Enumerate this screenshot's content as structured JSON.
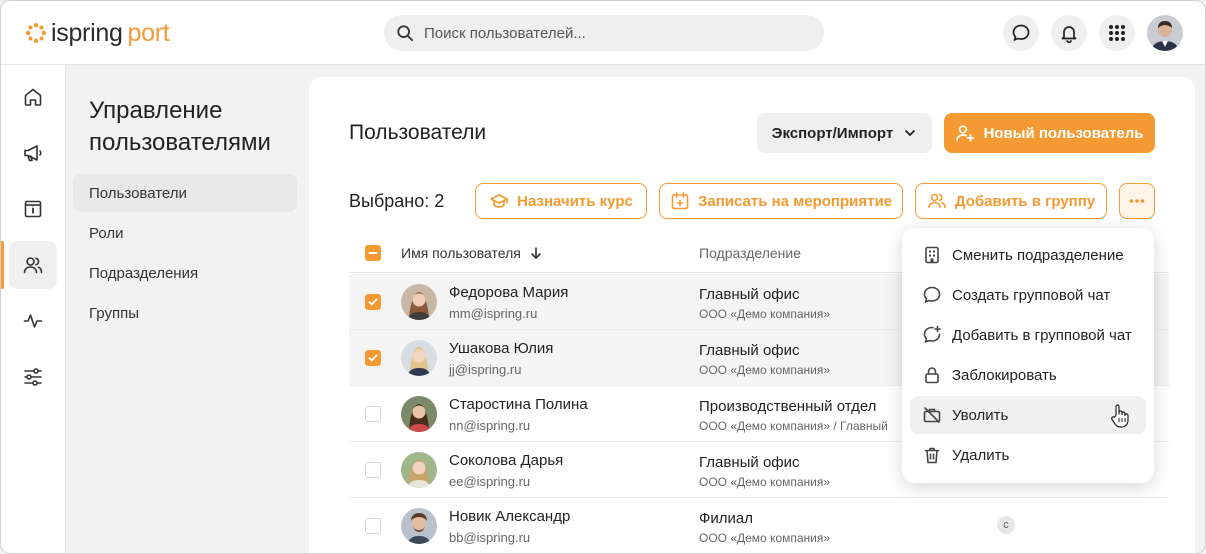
{
  "brand": {
    "logo_part1": "ispring",
    "logo_part2": "port",
    "accent": "#f59a32"
  },
  "search": {
    "placeholder": "Поиск пользователей..."
  },
  "header_icons": [
    "chat-icon",
    "bell-icon",
    "apps-grid-icon",
    "user-avatar"
  ],
  "rail": [
    "home-icon",
    "megaphone-icon",
    "info-board-icon",
    "users-icon",
    "activity-icon",
    "sliders-icon"
  ],
  "section": {
    "title": "Управление пользователями",
    "items": [
      {
        "label": "Пользователи",
        "active": true
      },
      {
        "label": "Роли",
        "active": false
      },
      {
        "label": "Подразделения",
        "active": false
      },
      {
        "label": "Группы",
        "active": false
      }
    ]
  },
  "main": {
    "title": "Пользователи",
    "export_label": "Экспорт/Импорт",
    "new_user_label": "Новый пользователь",
    "selected_text": "Выбрано: 2",
    "actions": {
      "assign_course": "Назначить курс",
      "enroll_event": "Записать на мероприятие",
      "add_to_group": "Добавить в группу"
    }
  },
  "table": {
    "col_name": "Имя пользователя",
    "col_department": "Подразделение",
    "rows": [
      {
        "name": "Федорова Мария",
        "email": "mm@ispring.ru",
        "department": "Главный офис",
        "company": "ООО «Демо компания»",
        "selected": true
      },
      {
        "name": "Ушакова Юлия",
        "email": "jj@ispring.ru",
        "department": "Главный офис",
        "company": "ООО «Демо компания»",
        "selected": true
      },
      {
        "name": "Старостина Полина",
        "email": "nn@ispring.ru",
        "department": "Производственный отдел",
        "company": "ООО «Демо компания» / Главный",
        "selected": false
      },
      {
        "name": "Соколова Дарья",
        "email": "ee@ispring.ru",
        "department": "Главный офис",
        "company": "ООО «Демо компания»",
        "selected": false
      },
      {
        "name": "Новик Александр",
        "email": "bb@ispring.ru",
        "department": "Филиал",
        "company": "ООО «Демо компания»",
        "selected": false,
        "badge": "c"
      }
    ]
  },
  "menu": {
    "items": [
      {
        "label": "Сменить подразделение",
        "icon": "building-icon"
      },
      {
        "label": "Создать групповой чат",
        "icon": "chat-bubble-icon"
      },
      {
        "label": "Добавить в групповой чат",
        "icon": "chat-add-icon"
      },
      {
        "label": "Заблокировать",
        "icon": "lock-icon"
      },
      {
        "label": "Уволить",
        "icon": "briefcase-off-icon",
        "hover": true
      },
      {
        "label": "Удалить",
        "icon": "trash-icon"
      }
    ]
  }
}
